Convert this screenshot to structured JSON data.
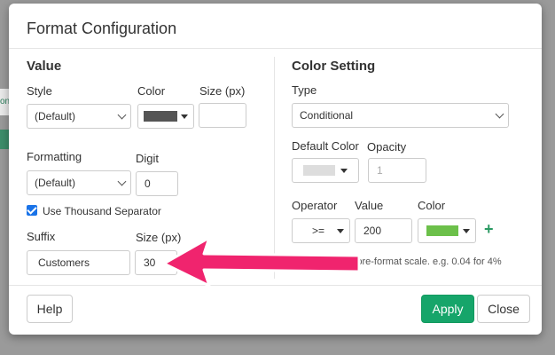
{
  "background": {
    "left_strip_text": "ons"
  },
  "dialog": {
    "title": "Format Configuration"
  },
  "value_section": {
    "title": "Value",
    "style_label": "Style",
    "style_value": "(Default)",
    "color_label": "Color",
    "color_value": "#555555",
    "size_label": "Size (px)",
    "size_value": "",
    "formatting_label": "Formatting",
    "formatting_value": "(Default)",
    "digit_label": "Digit",
    "digit_value": "0",
    "thousand_separator_label": "Use Thousand Separator",
    "thousand_separator_checked": true,
    "suffix_label": "Suffix",
    "suffix_value": "Customers",
    "suffix_size_label": "Size (px)",
    "suffix_size_value": "30"
  },
  "color_section": {
    "title": "Color Setting",
    "type_label": "Type",
    "type_value": "Conditional",
    "default_color_label": "Default Color",
    "default_color_value": "#dddddd",
    "opacity_label": "Opacity",
    "opacity_placeholder": "1",
    "operator_label": "Operator",
    "operator_value": ">=",
    "value_label": "Value",
    "value_value": "200",
    "color_label": "Color",
    "color_value": "#6cc04a",
    "hint": "Type values in pre-format scale. e.g. 0.04 for 4%"
  },
  "footer": {
    "help_label": "Help",
    "apply_label": "Apply",
    "close_label": "Close"
  },
  "colors": {
    "accent": "#16a56a",
    "annotation_arrow": "#f0246e"
  }
}
